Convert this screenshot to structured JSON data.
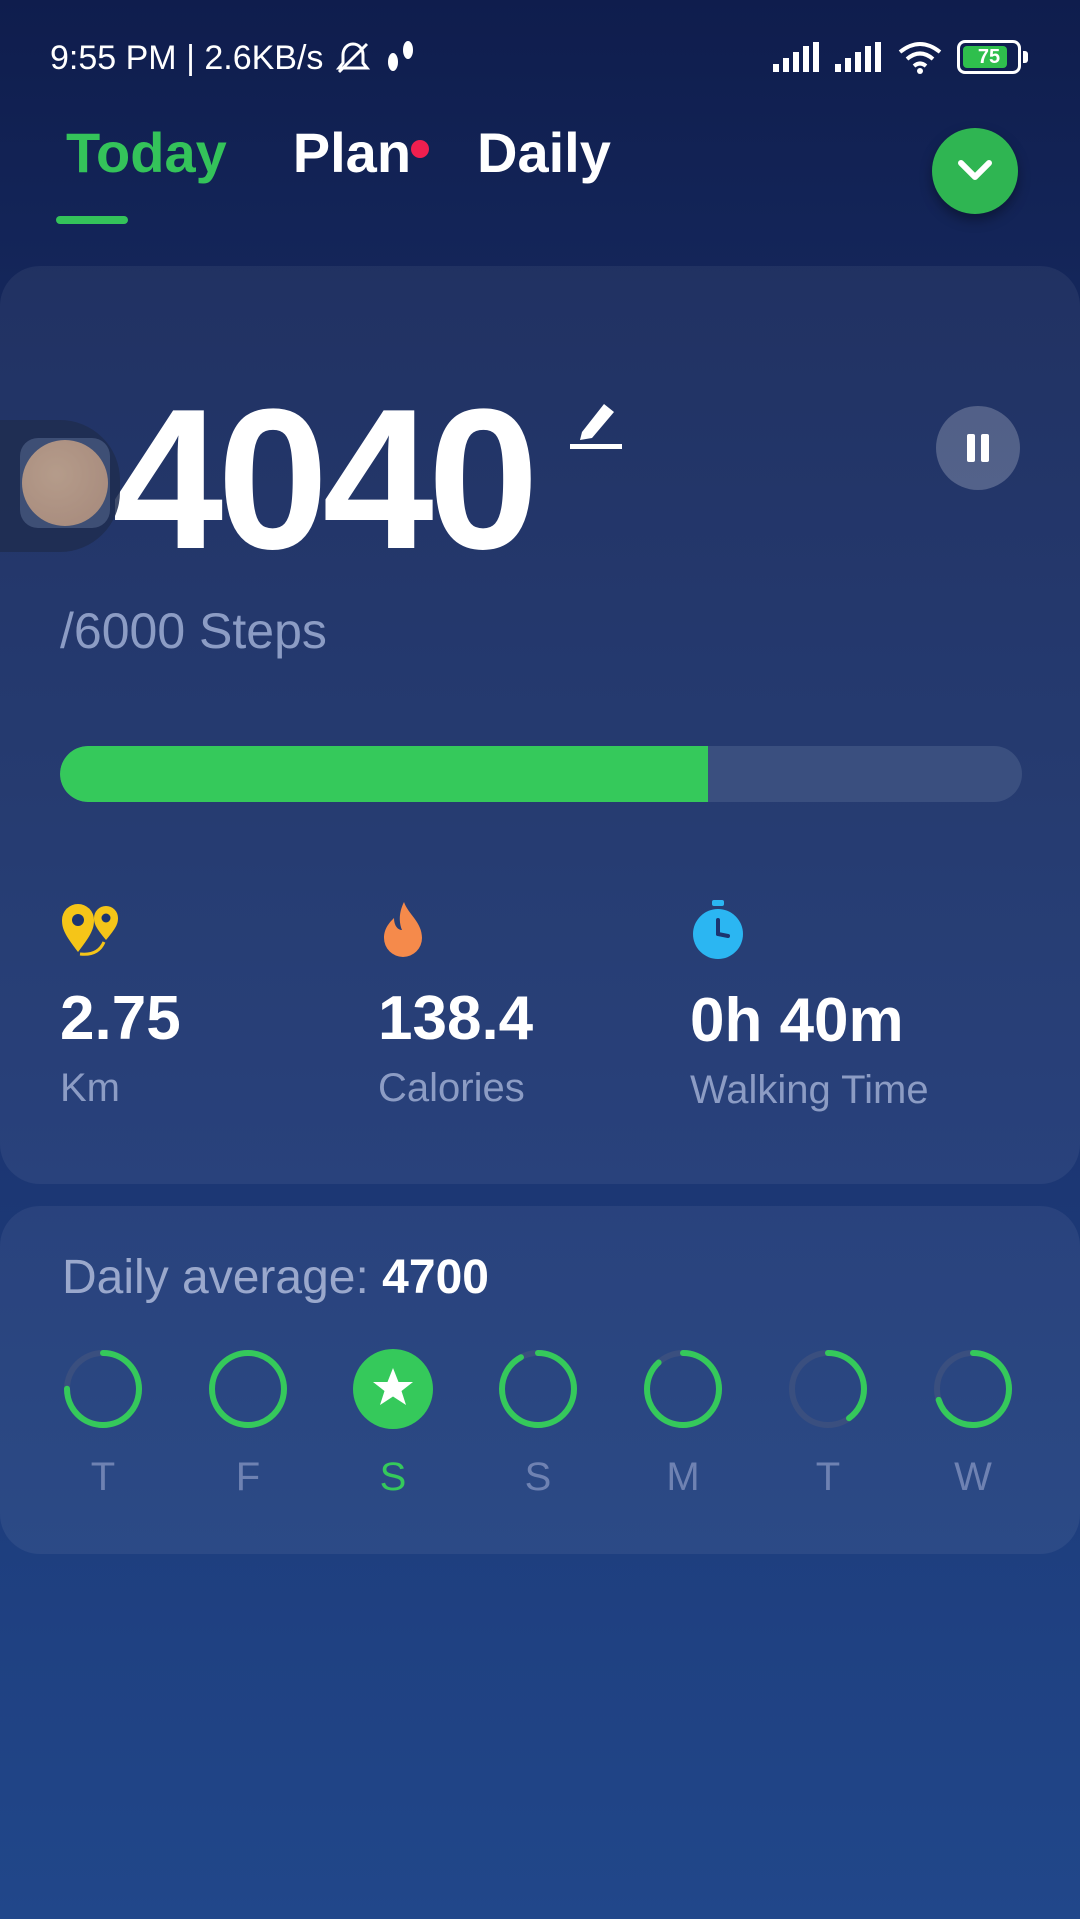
{
  "status": {
    "time_speed": "9:55 PM | 2.6KB/s",
    "battery": "75"
  },
  "tabs": [
    {
      "label": "Today",
      "active": true
    },
    {
      "label": "Plan",
      "active": false,
      "badge": true
    },
    {
      "label": "Daily",
      "active": false
    }
  ],
  "steps": {
    "value": "4040",
    "goal_text": "/6000 Steps",
    "progress_fraction": 0.6733
  },
  "stats": [
    {
      "value": "2.75",
      "label": "Km",
      "icon": "distance-pin-icon",
      "color": "#f5c518"
    },
    {
      "value": "138.4",
      "label": "Calories",
      "icon": "flame-icon",
      "color": "#f58a4b"
    },
    {
      "value": "0h 40m",
      "label": "Walking Time",
      "icon": "stopwatch-icon",
      "color": "#2bb6f2"
    }
  ],
  "daily_average": {
    "label": "Daily average:",
    "value": "4700"
  },
  "week": [
    {
      "label": "T",
      "progress": 0.75
    },
    {
      "label": "F",
      "progress": 1.0
    },
    {
      "label": "S",
      "progress": 1.0,
      "today": true
    },
    {
      "label": "S",
      "progress": 0.92
    },
    {
      "label": "M",
      "progress": 0.88
    },
    {
      "label": "T",
      "progress": 0.4
    },
    {
      "label": "W",
      "progress": 0.7
    }
  ],
  "colors": {
    "accent": "#35c95b",
    "track": "#3a4f7f",
    "badge": "#f01f4f"
  }
}
